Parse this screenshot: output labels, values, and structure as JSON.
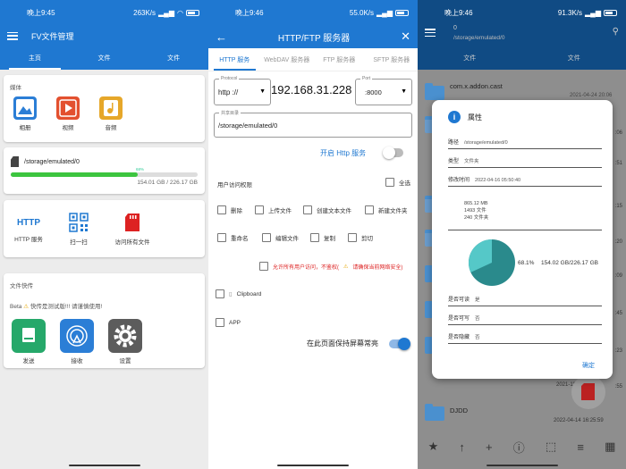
{
  "colors": {
    "primary": "#1f78d1",
    "green": "#3cc53f",
    "red": "#d22",
    "overlay": "#8e8e8e"
  },
  "panel1": {
    "status": {
      "time": "晚上9:45",
      "speed": "263K/s"
    },
    "title": "FV文件管理",
    "tabs": [
      "主页",
      "文件",
      "文件"
    ],
    "media": {
      "title": "媒体",
      "items": [
        "相册",
        "视频",
        "音频"
      ]
    },
    "storage": {
      "path": "/storage/emulated/0",
      "percent": "68%",
      "fraction": 0.68,
      "used": "154.01 GB",
      "sep": "/",
      "total": "226.17 GB"
    },
    "tools": {
      "items": [
        "HTTP 服务",
        "扫一扫",
        "访问所有文件"
      ],
      "http_icon_text": "HTTP"
    },
    "quick": {
      "title": "文件快传",
      "beta": "Beta",
      "beta_text": "快传是测试版!!! 请谨慎使用!",
      "items": [
        "发送",
        "接收",
        "设置"
      ]
    }
  },
  "panel2": {
    "status": {
      "time": "晚上9:46",
      "speed": "55.0K/s"
    },
    "title": "HTTP/FTP 服务器",
    "tabs": [
      "HTTP 服务",
      "WebDAV 服务器",
      "FTP 服务器",
      "SFTP 服务器"
    ],
    "protocol": {
      "label": "Protocol",
      "value": "http ://"
    },
    "ip": "192.168.31.228",
    "port": {
      "label": "Port",
      "value": ":8000"
    },
    "share": {
      "label": "共享目录",
      "value": "/storage/emulated/0"
    },
    "start_label": "开启 Http 服务",
    "perms_title": "用户访问权限",
    "select_all": "全选",
    "perms": [
      "删除",
      "上传文件",
      "创建文本文件",
      "新建文件夹",
      "重命名",
      "编辑文件",
      "复制",
      "剪切"
    ],
    "allow_all": "允许所有用户访问，不鉴权(",
    "allow_all_warn": "请确保当前网络安全)",
    "clipboard": "Clipboard",
    "app": "APP",
    "keep_screen": "在此页面保持屏幕常亮"
  },
  "panel3": {
    "status": {
      "time": "晚上9:46",
      "speed": "91.3K/s"
    },
    "count": "0",
    "path": "/storage/emulated/0",
    "tabs": [
      "文件",
      "文件"
    ],
    "bg_items": [
      {
        "name": "com.x.addon.cast",
        "date": "2021-04-24 20:06"
      },
      {
        "name": "DJDD",
        "date": "2022-04-14 16:25:59"
      }
    ],
    "bg_side_times": [
      ":06",
      ":51",
      ":15",
      ":20",
      ":09",
      ":45",
      ":23",
      ":55"
    ],
    "bg_date_partial": "2021-11",
    "dialog": {
      "title": "属性",
      "path_label": "路径",
      "path": "/storage/emulated/0",
      "type_label": "类型",
      "type": "文件夹",
      "mtime_label": "修改时间",
      "mtime": "2022-04-16 05:50:40",
      "size": "865.12 MB",
      "files": "1493 文件",
      "folders": "240 文件夹",
      "pie_percent": "68.1%",
      "pie_fraction": 0.681,
      "pie_text": "154.02 GB/226.17 GB",
      "readable_label": "是否可读",
      "readable": "是",
      "writable_label": "是否可写",
      "writable": "否",
      "hidden_label": "是否隐藏",
      "hidden": "否",
      "ok": "确定"
    }
  }
}
